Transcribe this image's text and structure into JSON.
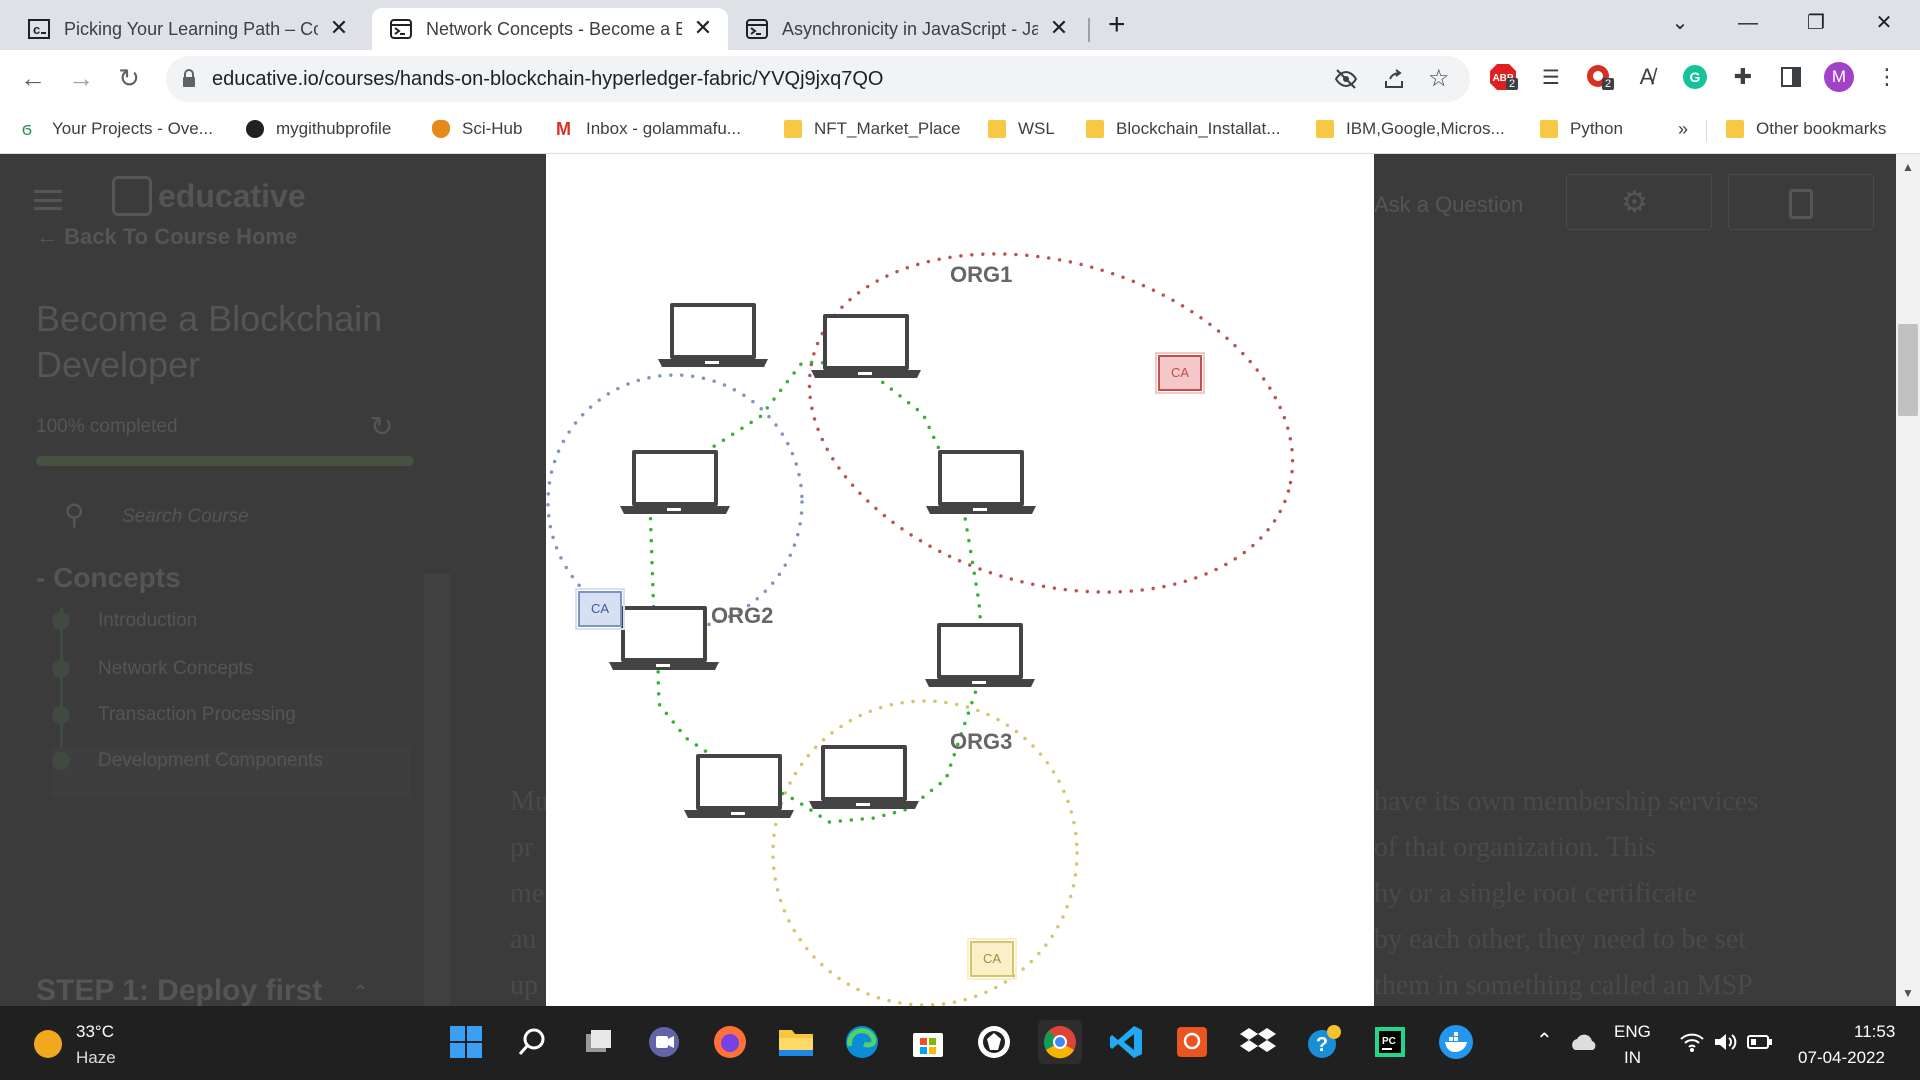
{
  "browser": {
    "tabs": [
      {
        "title": "Picking Your Learning Path – Cod",
        "close": "✕",
        "favicon": "educative-c-icon"
      },
      {
        "title": "Network Concepts - Become a Bl",
        "close": "✕",
        "favicon": "terminal-window-icon"
      },
      {
        "title": "Asynchronicity in JavaScript - Jav",
        "close": "✕",
        "favicon": "terminal-window-icon"
      }
    ],
    "new_tab": "+",
    "url": "educative.io/courses/hands-on-blockchain-hyperledger-fabric/YVQj9jxq7QO",
    "ext_badge_abp": "2",
    "ext_badge_2": "2",
    "profile_initial": "M",
    "bookmarks": [
      "Your Projects - Ove...",
      "mygithubprofile",
      "Sci-Hub",
      "Inbox - golammafu...",
      "NFT_Market_Place",
      "WSL",
      "Blockchain_Installat...",
      "IBM,Google,Micros...",
      "Python"
    ],
    "bookmarks_overflow": "»",
    "other_bookmarks": "Other bookmarks"
  },
  "page": {
    "logo_text": "educative",
    "ask_question": "Ask a Question",
    "back_link": "Back To Course Home",
    "course_title_1": "Become a Blockchain",
    "course_title_2": "Developer",
    "progress_text": "100% completed",
    "progress_fraction": 1.0,
    "search_placeholder": "Search Course",
    "section_title": "- Concepts",
    "lessons": [
      "Introduction",
      "Network Concepts",
      "Transaction Processing",
      "Development Components"
    ],
    "step_title": "STEP 1: Deploy first",
    "prose_left": [
      "Mu",
      "pr",
      "me",
      "au",
      "up"
    ],
    "prose_right": [
      "have its own membership services",
      "of that organization. This",
      "hy or a single root certificate",
      "by each other, they need to be set",
      "them in something called an MSP"
    ]
  },
  "diagram": {
    "org1": "ORG1",
    "org2": "ORG2",
    "org3": "ORG3",
    "ca_label": "CA",
    "colors": {
      "org1": "#c0504d",
      "org2": "#7f93c4",
      "org3": "#d9c36a",
      "link": "#33b233"
    }
  },
  "taskbar": {
    "temperature": "33°C",
    "weather": "Haze",
    "lang_1": "ENG",
    "lang_2": "IN",
    "time": "11:53",
    "date": "07-04-2022"
  }
}
